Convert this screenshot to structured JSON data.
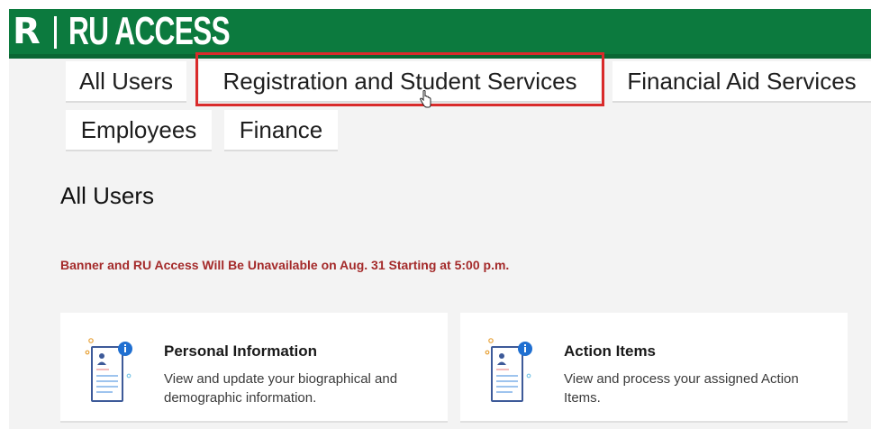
{
  "header": {
    "logo_letter": "R",
    "brand": "RU ACCESS"
  },
  "tabs": [
    {
      "label": "All Users"
    },
    {
      "label": "Registration and Student Services"
    },
    {
      "label": "Financial Aid Services"
    },
    {
      "label": "Employees"
    },
    {
      "label": "Finance"
    }
  ],
  "section": {
    "title": "All Users",
    "notice": "Banner and RU Access Will Be Unavailable on Aug. 31 Starting at 5:00 p.m."
  },
  "cards": [
    {
      "title": "Personal Information",
      "description": "View and update your biographical and demographic information.",
      "icon": "personal-info-icon"
    },
    {
      "title": "Action Items",
      "description": "View and process your assigned Action Items.",
      "icon": "action-items-icon"
    }
  ],
  "colors": {
    "header_green": "#0c7a3e",
    "highlight_red": "#d92b2b",
    "notice_red": "#a42a2a",
    "icon_blue": "#1f6fd1"
  }
}
